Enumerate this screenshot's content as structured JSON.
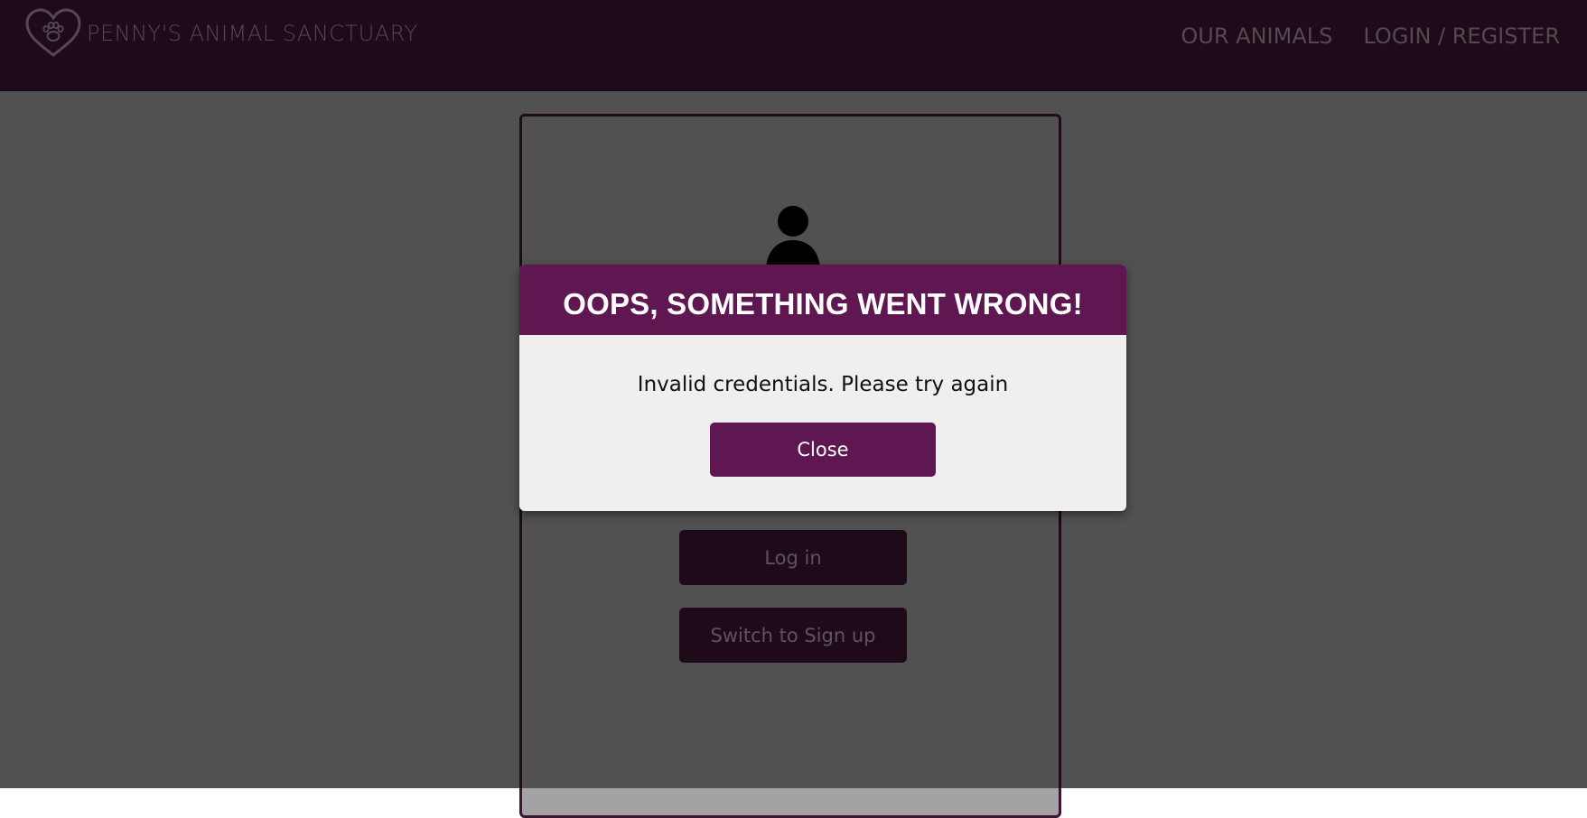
{
  "navbar": {
    "brand_name": "PENNY'S ANIMAL SANCTUARY",
    "links": [
      "OUR ANIMALS",
      "LOGIN / REGISTER"
    ]
  },
  "login_form": {
    "login_button": "Log in",
    "switch_button": "Switch to Sign up"
  },
  "modal": {
    "title": "OOPS, SOMETHING WENT WRONG!",
    "message": "Invalid credentials. Please try again",
    "close_label": "Close"
  },
  "colors": {
    "brand_purple": "#5e1750",
    "navbar_dark": "#3d1433",
    "modal_body": "#efefef"
  },
  "icons": [
    "heart-paw-logo-icon",
    "user-avatar-icon"
  ]
}
